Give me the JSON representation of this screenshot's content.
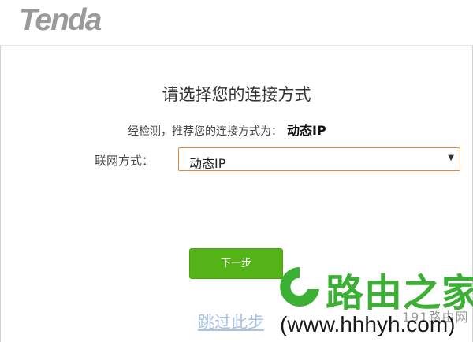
{
  "header": {
    "logo_text": "Tenda"
  },
  "main": {
    "title": "请选择您的连接方式",
    "detect_prefix": "经检测，推荐您的连接方式为：",
    "detect_value": "动态IP",
    "mode_label": "联网方式：",
    "mode_select": {
      "selected": "动态IP",
      "caret": "▼"
    },
    "next_button": "下一步",
    "skip_link": "跳过此步"
  },
  "watermark": {
    "name": "路由之家",
    "number": "191路由网",
    "url": "(www.hhhyh.com)",
    "color": "#3cb034"
  },
  "colors": {
    "accent_green": "#53b317",
    "select_border": "#e38a36",
    "link": "#a9c2e8",
    "logo_gray": "#9a9a9a"
  },
  "icons": [
    "select-caret-icon",
    "watermark-logo-icon"
  ]
}
